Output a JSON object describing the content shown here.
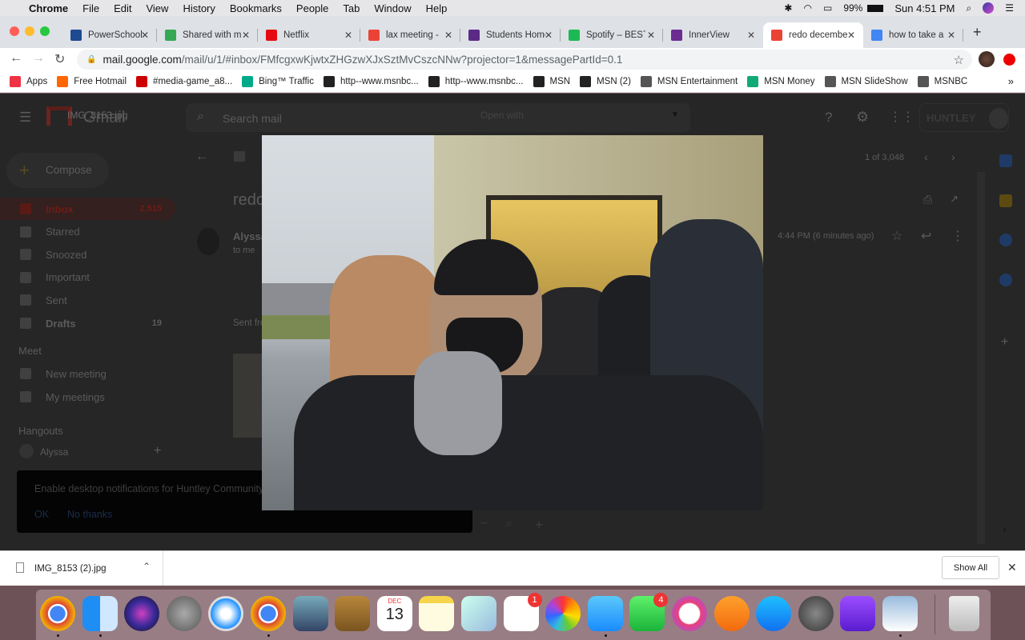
{
  "menubar": {
    "app": "Chrome",
    "items": [
      "File",
      "Edit",
      "View",
      "History",
      "Bookmarks",
      "People",
      "Tab",
      "Window",
      "Help"
    ],
    "battery": "99%",
    "clock": "Sun 4:51 PM"
  },
  "tabs": [
    {
      "label": "PowerSchool",
      "color": "#1e4b8f",
      "glyph": "P"
    },
    {
      "label": "Shared with me",
      "color": "#34a853",
      "glyph": "▲"
    },
    {
      "label": "Netflix",
      "color": "#e50914",
      "glyph": "N"
    },
    {
      "label": "lax meeting - ",
      "color": "#ea4335",
      "glyph": "M"
    },
    {
      "label": "Students Home",
      "color": "#5b2a86",
      "glyph": "✦"
    },
    {
      "label": "Spotify – BEST",
      "color": "#1db954",
      "glyph": "≋"
    },
    {
      "label": "InnerView",
      "color": "#6a2c91",
      "glyph": "✣"
    },
    {
      "label": "redo december",
      "color": "#ea4335",
      "glyph": "M"
    },
    {
      "label": "how to take a",
      "color": "#4285f4",
      "glyph": "G"
    }
  ],
  "address": {
    "host": "mail.google.com",
    "path": "/mail/u/1/#inbox/FMfcgxwKjwtxZHGzwXJxSztMvCszcNNw?projector=1&messagePartId=0.1"
  },
  "bookmarks": [
    "Apps",
    "Free Hotmail",
    "#media-game_a8...",
    "Bing™ Traffic",
    "http--www.msnbc...",
    "http--www.msnbc...",
    "MSN",
    "MSN (2)",
    "MSN Entertainment",
    "MSN Money",
    "MSN SlideShow",
    "MSNBC"
  ],
  "gmail": {
    "logo": "Gmail",
    "file_title": "IMG_8153.jpg",
    "search_placeholder": "Search mail",
    "open_with": "Open with",
    "compose": "Compose",
    "nav": [
      {
        "label": "Inbox",
        "count": "2,515"
      },
      {
        "label": "Starred",
        "count": ""
      },
      {
        "label": "Snoozed",
        "count": ""
      },
      {
        "label": "Important",
        "count": ""
      },
      {
        "label": "Sent",
        "count": ""
      },
      {
        "label": "Drafts",
        "count": "19"
      }
    ],
    "meet_header": "Meet",
    "meet": [
      "New meeting",
      "My meetings"
    ],
    "hangouts_header": "Hangouts",
    "hangouts_user": "Alyssa",
    "notification": {
      "text": "Enable desktop notifications for Huntley Community School District",
      "ok": "OK",
      "no": "No thanks"
    },
    "pager": "1 of 3,048",
    "subject": "redo december",
    "sender": "Alyssa",
    "to": "to me",
    "time": "4:44 PM (6 minutes ago)",
    "sent_from": "Sent from my iPhone",
    "org": "HUNTLEY"
  },
  "download": {
    "file": "IMG_8153 (2).jpg",
    "show_all": "Show All"
  },
  "dock": {
    "badges": {
      "reminders": "1",
      "facetime": "4"
    },
    "calendar_month": "DEC",
    "calendar_day": "13"
  }
}
